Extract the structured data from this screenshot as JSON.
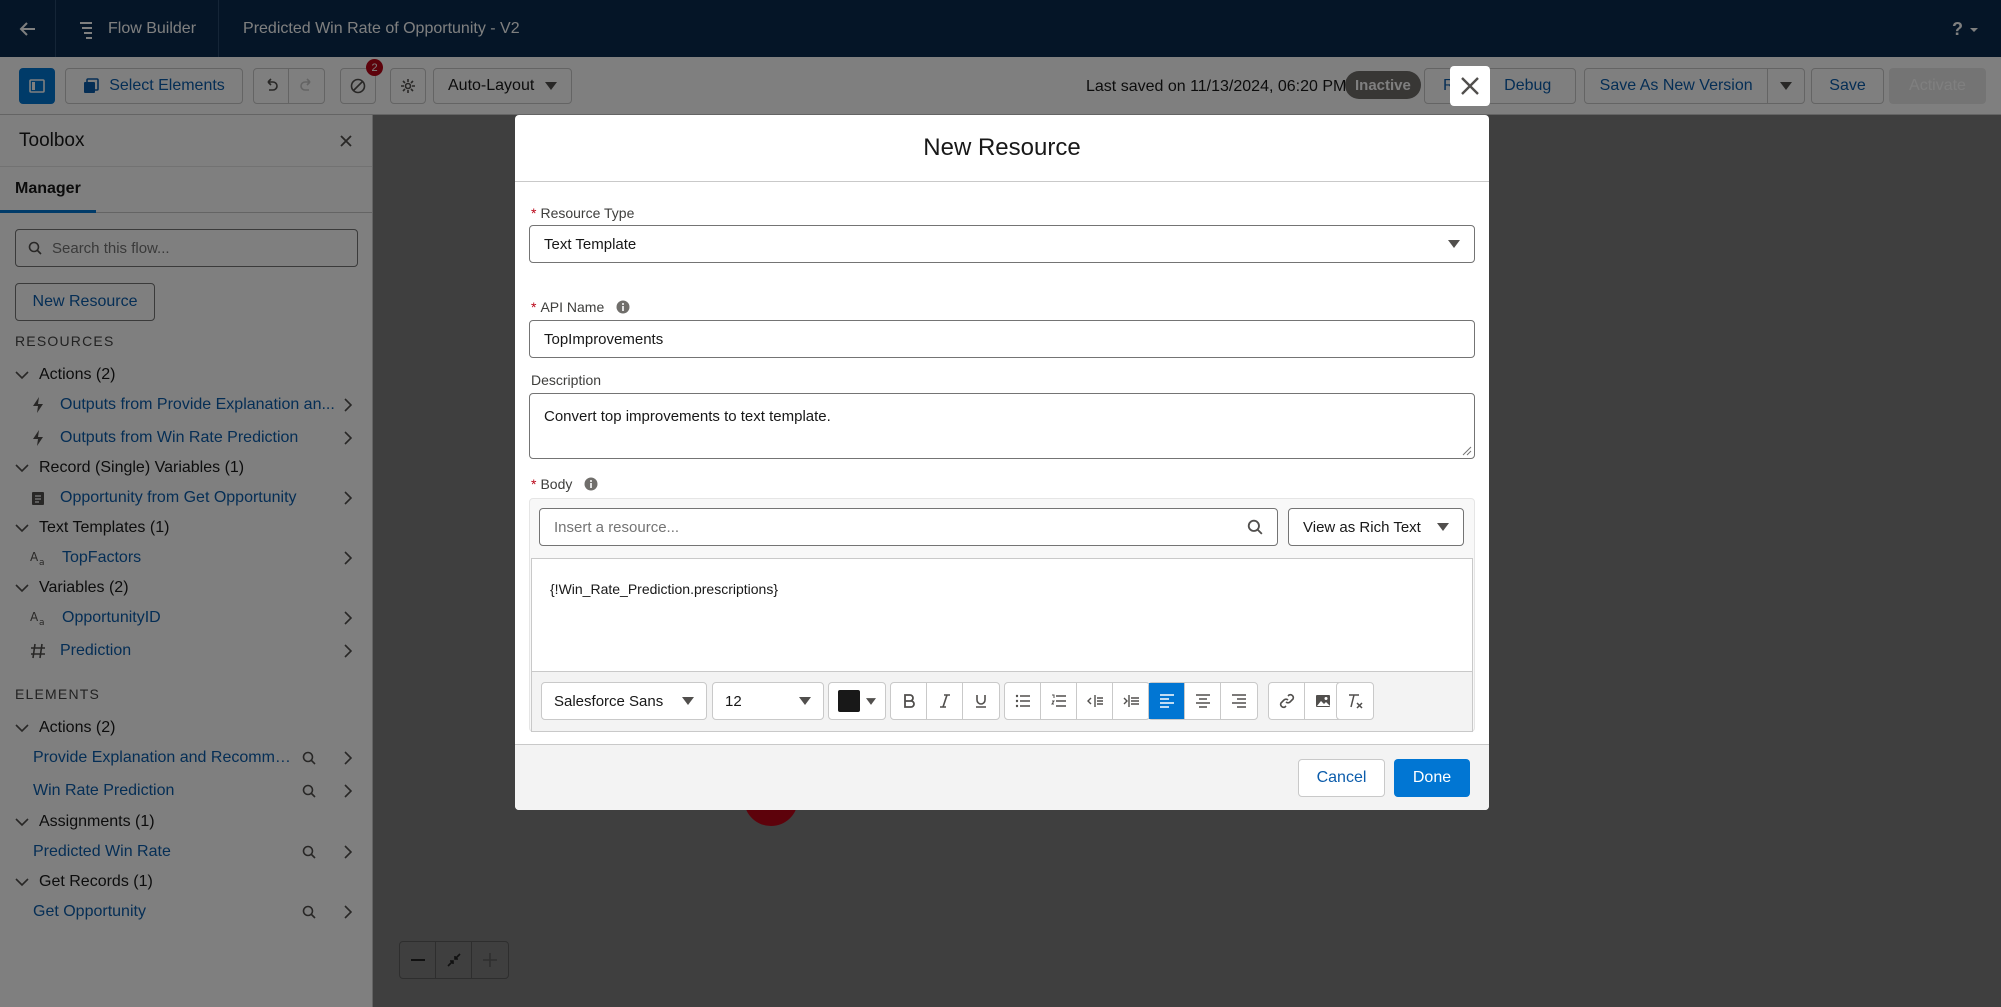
{
  "app": {
    "back_icon": "arrow-left-icon",
    "brand": "Flow Builder",
    "flow_name": "Predicted Win Rate of Opportunity - V2",
    "help": "?"
  },
  "toolbar": {
    "select_elements": "Select Elements",
    "errors_count": "2",
    "layout": "Auto-Layout",
    "last_saved": "Last saved on 11/13/2024, 06:20 PM",
    "status": "Inactive",
    "run_partial": "R",
    "debug": "Debug",
    "save_as_new": "Save As New Version",
    "save": "Save",
    "activate": "Activate"
  },
  "sidebar": {
    "title": "Toolbox",
    "tab": "Manager",
    "search_placeholder": "Search this flow...",
    "new_resource": "New Resource",
    "resources_title": "RESOURCES",
    "resources": [
      {
        "group": "Actions (2)",
        "items": [
          "Outputs from Provide Explanation an...",
          "Outputs from Win Rate Prediction"
        ]
      },
      {
        "group": "Record (Single) Variables (1)",
        "items": [
          "Opportunity from Get Opportunity"
        ]
      },
      {
        "group": "Text Templates (1)",
        "items": [
          "TopFactors"
        ]
      },
      {
        "group": "Variables (2)",
        "items": [
          "OpportunityID",
          "Prediction"
        ]
      }
    ],
    "elements_title": "ELEMENTS",
    "elements": [
      {
        "group": "Actions (2)",
        "items": [
          "Provide Explanation and Recommen...",
          "Win Rate Prediction"
        ]
      },
      {
        "group": "Assignments (1)",
        "items": [
          "Predicted Win Rate"
        ]
      },
      {
        "group": "Get Records (1)",
        "items": [
          "Get Opportunity"
        ]
      }
    ]
  },
  "modal": {
    "title": "New Resource",
    "resource_type_label": "Resource Type",
    "resource_type_value": "Text Template",
    "api_name_label": "API Name",
    "api_name_value": "TopImprovements",
    "description_label": "Description",
    "description_value": "Convert top improvements to text template.",
    "body_label": "Body",
    "insert_placeholder": "Insert a resource...",
    "view_mode": "View as Rich Text",
    "body_content": "{!Win_Rate_Prediction.prescriptions}",
    "font": "Salesforce Sans",
    "font_size": "12",
    "cancel": "Cancel",
    "done": "Done"
  },
  "colors": {
    "nav": "#0a2b4f",
    "brand": "#0176d3",
    "link": "#0b5cab",
    "error": "#ba0517"
  }
}
